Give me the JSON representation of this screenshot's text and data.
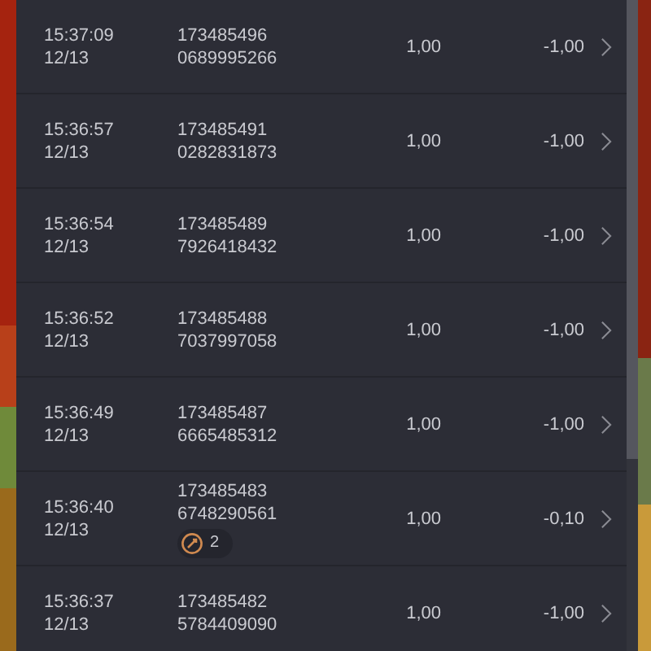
{
  "rows": [
    {
      "time": "15:37:09",
      "date": "12/13",
      "order": "173485496",
      "code": "0689995266",
      "amount": "1,00",
      "result": "-1,00"
    },
    {
      "time": "15:36:57",
      "date": "12/13",
      "order": "173485491",
      "code": "0282831873",
      "amount": "1,00",
      "result": "-1,00"
    },
    {
      "time": "15:36:54",
      "date": "12/13",
      "order": "173485489",
      "code": "7926418432",
      "amount": "1,00",
      "result": "-1,00"
    },
    {
      "time": "15:36:52",
      "date": "12/13",
      "order": "173485488",
      "code": "7037997058",
      "amount": "1,00",
      "result": "-1,00"
    },
    {
      "time": "15:36:49",
      "date": "12/13",
      "order": "173485487",
      "code": "6665485312",
      "amount": "1,00",
      "result": "-1,00"
    },
    {
      "time": "15:36:40",
      "date": "12/13",
      "order": "173485483",
      "code": "6748290561",
      "amount": "1,00",
      "result": "-0,10",
      "badge": {
        "count": "2"
      }
    },
    {
      "time": "15:36:37",
      "date": "12/13",
      "order": "173485482",
      "code": "5784409090",
      "amount": "1,00",
      "result": "-1,00"
    }
  ]
}
